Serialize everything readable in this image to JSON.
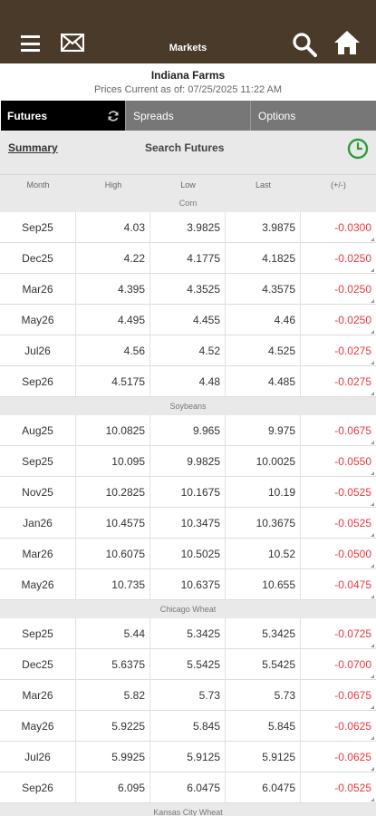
{
  "header": {
    "title": "Markets"
  },
  "company": "Indiana Farms",
  "prices_current": "Prices Current as of: 07/25/2025 11:22 AM",
  "tabs": [
    {
      "label": "Futures"
    },
    {
      "label": "Spreads"
    },
    {
      "label": "Options"
    }
  ],
  "summary_label": "Summary",
  "search_label": "Search Futures",
  "columns": [
    "Month",
    "High",
    "Low",
    "Last",
    "(+/-)"
  ],
  "groups": [
    {
      "name": "Corn",
      "rows": [
        [
          "Sep25",
          "4.03",
          "3.9825",
          "3.9875",
          "-0.0300"
        ],
        [
          "Dec25",
          "4.22",
          "4.1775",
          "4.1825",
          "-0.0250"
        ],
        [
          "Mar26",
          "4.395",
          "4.3525",
          "4.3575",
          "-0.0250"
        ],
        [
          "May26",
          "4.495",
          "4.455",
          "4.46",
          "-0.0250"
        ],
        [
          "Jul26",
          "4.56",
          "4.52",
          "4.525",
          "-0.0275"
        ],
        [
          "Sep26",
          "4.5175",
          "4.48",
          "4.485",
          "-0.0275"
        ]
      ]
    },
    {
      "name": "Soybeans",
      "rows": [
        [
          "Aug25",
          "10.0825",
          "9.965",
          "9.975",
          "-0.0675"
        ],
        [
          "Sep25",
          "10.095",
          "9.9825",
          "10.0025",
          "-0.0550"
        ],
        [
          "Nov25",
          "10.2825",
          "10.1675",
          "10.19",
          "-0.0525"
        ],
        [
          "Jan26",
          "10.4575",
          "10.3475",
          "10.3675",
          "-0.0525"
        ],
        [
          "Mar26",
          "10.6075",
          "10.5025",
          "10.52",
          "-0.0500"
        ],
        [
          "May26",
          "10.735",
          "10.6375",
          "10.655",
          "-0.0475"
        ]
      ]
    },
    {
      "name": "Chicago Wheat",
      "rows": [
        [
          "Sep25",
          "5.44",
          "5.3425",
          "5.3425",
          "-0.0725"
        ],
        [
          "Dec25",
          "5.6375",
          "5.5425",
          "5.5425",
          "-0.0700"
        ],
        [
          "Mar26",
          "5.82",
          "5.73",
          "5.73",
          "-0.0675"
        ],
        [
          "May26",
          "5.9225",
          "5.845",
          "5.845",
          "-0.0625"
        ],
        [
          "Jul26",
          "5.9925",
          "5.9125",
          "5.9125",
          "-0.0625"
        ],
        [
          "Sep26",
          "6.095",
          "6.0475",
          "6.0475",
          "-0.0525"
        ]
      ]
    },
    {
      "name": "Kansas City Wheat",
      "rows": []
    }
  ],
  "colors": {
    "header_bg": "#4a3a2a",
    "negative": "#e8383d",
    "clock_accent": "#2e9b3a",
    "active_tab": "#000000",
    "inactive_tab": "#777777"
  },
  "icons": [
    "hamburger-menu-icon",
    "mail-icon",
    "search-icon",
    "home-icon",
    "refresh-icon",
    "clock-icon"
  ]
}
